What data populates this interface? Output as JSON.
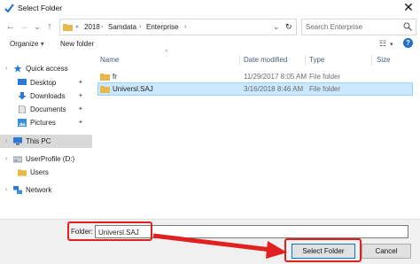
{
  "window": {
    "title": "Select Folder",
    "close_glyph": "✕"
  },
  "nav": {
    "back_glyph": "←",
    "forward_glyph": "→",
    "dropdown_glyph": "⌄",
    "up_glyph": "↑",
    "breadcrumb": [
      "«",
      "2018",
      "Samdata",
      "Enterprise"
    ],
    "refresh_glyph": "↻"
  },
  "search": {
    "placeholder": "Search Enterprise"
  },
  "toolbar": {
    "organize_label": "Organize",
    "organize_arrow": "▾",
    "new_folder_label": "New folder",
    "view_glyph": "☷",
    "view_arrow": "▾",
    "help_glyph": "?"
  },
  "sidebar": {
    "items": [
      {
        "label": "Quick access",
        "icon": "star-icon"
      },
      {
        "label": "Desktop",
        "icon": "desktop-icon",
        "pinned": true
      },
      {
        "label": "Downloads",
        "icon": "download-icon",
        "pinned": true
      },
      {
        "label": "Documents",
        "icon": "documents-icon",
        "pinned": true
      },
      {
        "label": "Pictures",
        "icon": "pictures-icon",
        "pinned": true
      },
      {
        "label": "This PC",
        "icon": "computer-icon",
        "selected": true
      },
      {
        "label": "UserProfile (D:)",
        "icon": "drive-icon"
      },
      {
        "label": "Users",
        "icon": "folder-icon"
      },
      {
        "label": "Network",
        "icon": "network-icon"
      }
    ],
    "pin_glyph": "✦"
  },
  "columns": {
    "name": "Name",
    "date": "Date modified",
    "type": "Type",
    "size": "Size",
    "sort_glyph": "^"
  },
  "files": [
    {
      "name": "fr",
      "date": "11/29/2017 8:05 AM",
      "type": "File folder",
      "size": ""
    },
    {
      "name": "Universl.SAJ",
      "date": "3/16/2018 8:46 AM",
      "type": "File folder",
      "size": "",
      "selected": true
    }
  ],
  "footer": {
    "folder_label": "Folder:",
    "folder_value": "Universl.SAJ",
    "select_button": "Select Folder",
    "cancel_button": "Cancel"
  },
  "colors": {
    "accent": "#0078d7",
    "selection": "#cce8ff",
    "highlight": "#e12020",
    "folder": "#e8b84a"
  }
}
